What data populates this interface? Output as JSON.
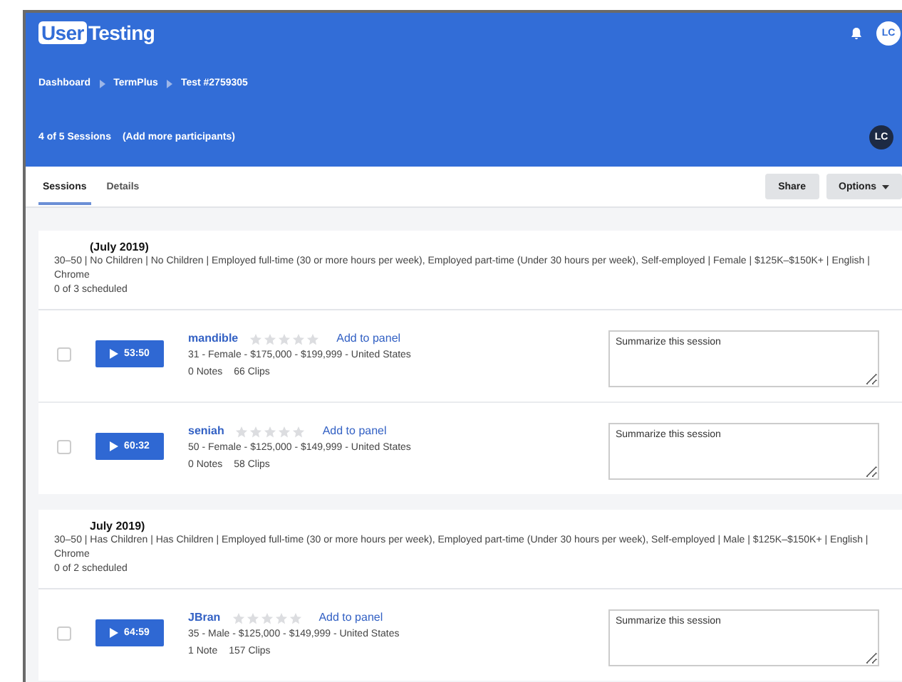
{
  "header": {
    "logo": {
      "boxed": "User",
      "rest": "Testing"
    },
    "avatar": "LC",
    "breadcrumbs": [
      "Dashboard",
      "TermPlus",
      "Test #2759305"
    ],
    "sessions_count": "4 of 5 Sessions",
    "add_participants": "(Add more participants)",
    "owner_avatar": "LC"
  },
  "tabs": [
    {
      "label": "Sessions",
      "selected": true
    },
    {
      "label": "Details",
      "selected": false
    }
  ],
  "actions": {
    "share": "Share",
    "options": "Options"
  },
  "groups": [
    {
      "title": "(July 2019)",
      "criteria": "30–50 | No Children | No Children | Employed full-time (30 or more hours per week), Employed part-time (Under 30 hours per week), Self-employed | Female | $125K–$150K+ | English | Chrome",
      "scheduled": "0 of 3 scheduled",
      "sessions": [
        {
          "checked": false,
          "duration": "53:50",
          "name": "mandible",
          "stars": 0,
          "add": "Add to panel",
          "details": "31 - Female - $175,000 - $199,999 - United States",
          "notes": "0 Notes",
          "clips": "66 Clips",
          "placeholder": "Summarize this session"
        },
        {
          "checked": false,
          "duration": "60:32",
          "name": "seniah",
          "stars": 0,
          "add": "Add to panel",
          "details": "50 - Female - $125,000 - $149,999 - United States",
          "notes": "0 Notes",
          "clips": "58 Clips",
          "placeholder": "Summarize this session"
        }
      ]
    },
    {
      "title": "July 2019)",
      "criteria": "30–50 | Has Children | Has Children | Employed full-time (30 or more hours per week), Employed part-time (Under 30 hours per week), Self-employed | Male | $125K–$150K+ | English | Chrome",
      "scheduled": "0 of 2 scheduled",
      "sessions": [
        {
          "checked": false,
          "duration": "64:59",
          "name": "JBran",
          "stars": 0,
          "add": "Add to panel",
          "details": "35 - Male - $125,000 - $149,999 - United States",
          "notes": "1 Note",
          "clips": "157 Clips",
          "placeholder": "Summarize this session"
        }
      ]
    }
  ]
}
